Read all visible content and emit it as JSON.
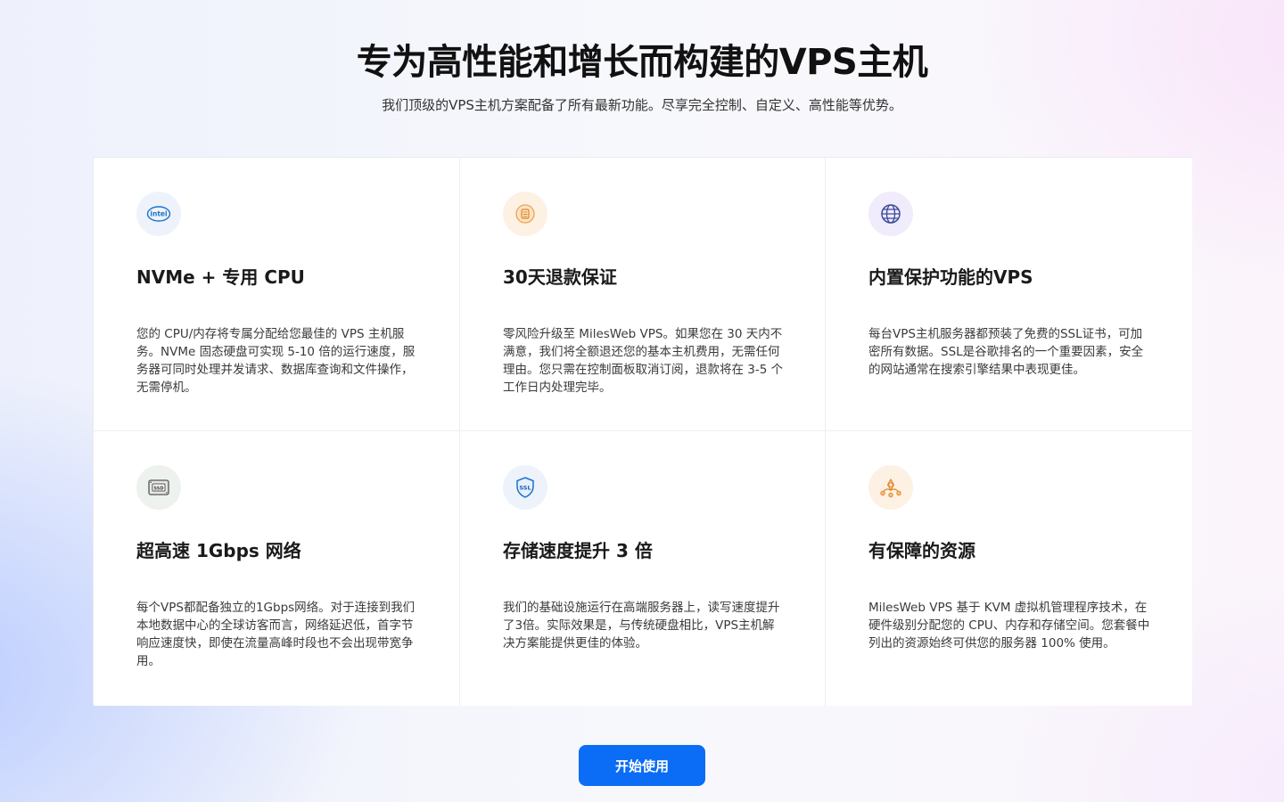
{
  "header": {
    "title": "专为高性能和增长而构建的VPS主机",
    "subtitle": "我们顶级的VPS主机方案配备了所有最新功能。尽享完全控制、自定义、高性能等优势。"
  },
  "features": [
    {
      "icon": "intel-icon",
      "icon_bg": "#eef3fb",
      "title": "NVMe + 专用 CPU",
      "description": "您的 CPU/内存将专属分配给您最佳的 VPS 主机服务。NVMe 固态硬盘可实现 5-10 倍的运行速度，服务器可同时处理并发请求、数据库查询和文件操作，无需停机。"
    },
    {
      "icon": "coin-icon",
      "icon_bg": "#fdf1e4",
      "title": "30天退款保证",
      "description": "零风险升级至 MilesWeb VPS。如果您在 30 天内不满意，我们将全额退还您的基本主机费用，无需任何理由。您只需在控制面板取消订阅，退款将在 3-5 个工作日内处理完毕。"
    },
    {
      "icon": "globe-icon",
      "icon_bg": "#f1ecfb",
      "title": "内置保护功能的VPS",
      "description": "每台VPS主机服务器都预装了免费的SSL证书，可加密所有数据。SSL是谷歌排名的一个重要因素，安全的网站通常在搜索引擎结果中表现更佳。"
    },
    {
      "icon": "ssd-icon",
      "icon_bg": "#eef2ee",
      "title": "超高速 1Gbps 网络",
      "description": "每个VPS都配备独立的1Gbps网络。对于连接到我们本地数据中心的全球访客而言，网络延迟低，首字节响应速度快，即使在流量高峰时段也不会出现带宽争用。"
    },
    {
      "icon": "ssl-shield-icon",
      "icon_bg": "#eef3fb",
      "title": "存储速度提升 3 倍",
      "description": "我们的基础设施运行在高端服务器上，读写速度提升了3倍。实际效果是，与传统硬盘相比，VPS主机解决方案能提供更佳的体验。"
    },
    {
      "icon": "resources-icon",
      "icon_bg": "#fdf1e4",
      "title": "有保障的资源",
      "description": "MilesWeb VPS 基于 KVM 虚拟机管理程序技术，在硬件级别分配您的 CPU、内存和存储空间。您套餐中列出的资源始终可供您的服务器 100% 使用。"
    }
  ],
  "cta": {
    "label": "开始使用"
  },
  "colors": {
    "accent": "#0b6cf5",
    "intel_blue": "#1a73c9",
    "orange": "#f0a24a",
    "navy": "#3b4a9c"
  }
}
